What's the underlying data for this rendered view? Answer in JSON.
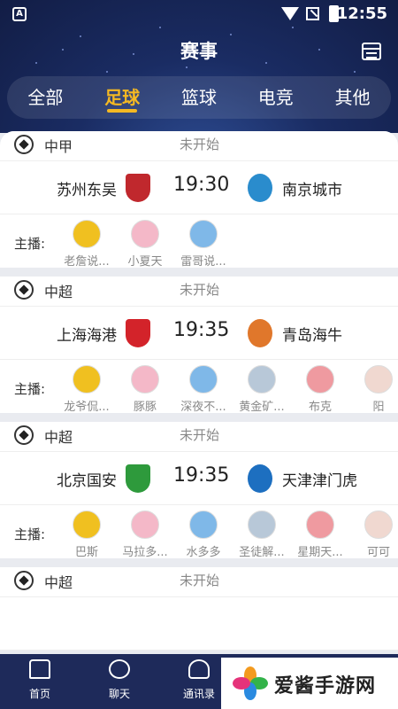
{
  "statusbar": {
    "time": "12:55",
    "app_badge": "A"
  },
  "header": {
    "title": "赛事"
  },
  "tabs": [
    {
      "label": "全部",
      "active": false
    },
    {
      "label": "足球",
      "active": true
    },
    {
      "label": "篮球",
      "active": false
    },
    {
      "label": "电竞",
      "active": false
    },
    {
      "label": "其他",
      "active": false
    }
  ],
  "host_label": "主播:",
  "matches": [
    {
      "league": "中甲",
      "status": "未开始",
      "home": "苏州东吴",
      "time": "19:30",
      "away": "南京城市",
      "home_color": "#c0282d",
      "away_color": "#2a8ccd",
      "hosts": [
        "老詹说...",
        "小夏天",
        "雷哥说..."
      ]
    },
    {
      "league": "中超",
      "status": "未开始",
      "home": "上海海港",
      "time": "19:35",
      "away": "青岛海牛",
      "home_color": "#d3232a",
      "away_color": "#e0772b",
      "hosts": [
        "龙爷侃...",
        "豚豚",
        "深夜不...",
        "黄金矿...",
        "布克",
        "阳"
      ]
    },
    {
      "league": "中超",
      "status": "未开始",
      "home": "北京国安",
      "time": "19:35",
      "away": "天津津门虎",
      "home_color": "#2e9a3c",
      "away_color": "#1d6fc0",
      "hosts": [
        "巴斯",
        "马拉多...",
        "水多多",
        "圣徒解...",
        "星期天...",
        "可可"
      ]
    },
    {
      "league": "中超",
      "status": "未开始",
      "home": "",
      "time": "",
      "away": "",
      "home_color": "#1d3f8c",
      "away_color": "#1d3f8c",
      "hosts": []
    }
  ],
  "bottom_nav": [
    {
      "label": "首页",
      "icon": "home-icon"
    },
    {
      "label": "聊天",
      "icon": "chat-icon"
    },
    {
      "label": "通讯录",
      "icon": "contacts-icon"
    }
  ],
  "watermark": {
    "text": "爱酱手游网"
  }
}
